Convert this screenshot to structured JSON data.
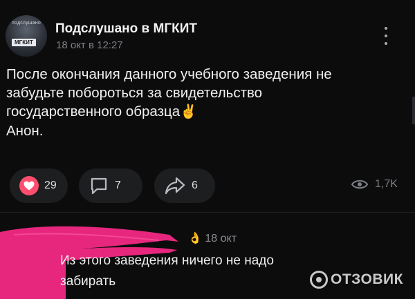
{
  "post": {
    "group_name": "Подслушано в МГКИТ",
    "date": "18 окт в 12:27",
    "avatar_caption": "подслушано",
    "avatar_sign": "МГКИТ",
    "text_lines": [
      "После окончания данного учебного заведения не",
      "забудьте побороться за свидетельство",
      "государственного образца",
      "Анон."
    ],
    "emoji": "✌️",
    "likes": "29",
    "comments": "7",
    "shares": "6",
    "views": "1,7K"
  },
  "comment": {
    "date": "18 окт",
    "text_lines": [
      "Из этого заведения ничего не надо",
      "забирать"
    ],
    "emoji": "👌"
  },
  "watermark": {
    "text": "ОТЗОВИК"
  },
  "colors": {
    "background": "#0c0c0d",
    "heart": "#ff4d6d",
    "redaction": "#e6277d"
  },
  "icons": [
    "more-vertical-icon",
    "heart-icon",
    "comment-icon",
    "share-icon",
    "eye-icon"
  ]
}
